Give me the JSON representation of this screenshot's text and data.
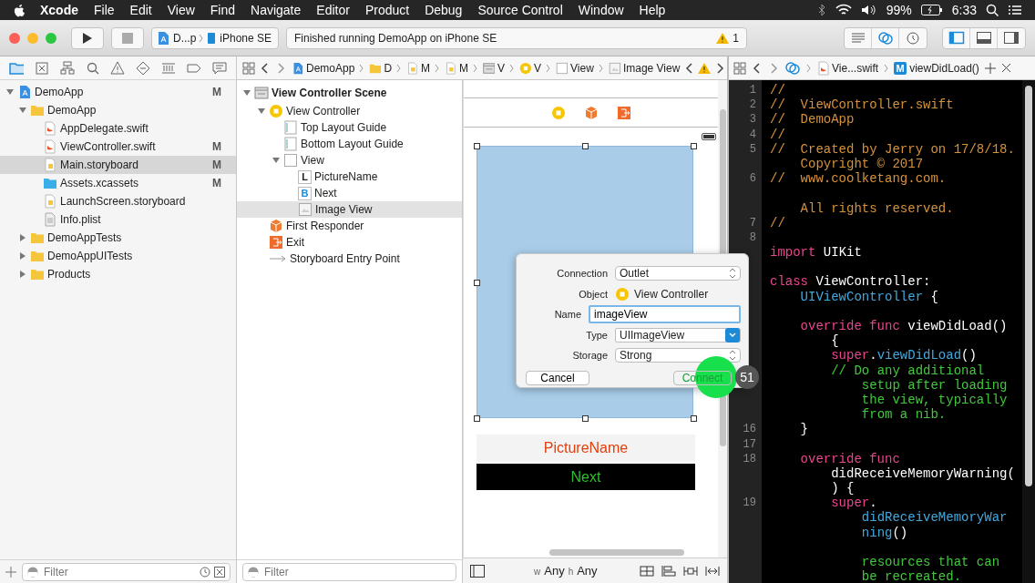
{
  "menu_bar": {
    "app": "Xcode",
    "menus": [
      "File",
      "Edit",
      "View",
      "Find",
      "Navigate",
      "Editor",
      "Product",
      "Debug",
      "Source Control",
      "Window",
      "Help"
    ],
    "battery": "99%",
    "time": "6:33"
  },
  "toolbar": {
    "scheme": "D...p",
    "device": "iPhone SE",
    "status": "Finished running DemoApp on iPhone SE",
    "warnings": "1"
  },
  "navigator": {
    "items": [
      {
        "label": "DemoApp",
        "kind": "project",
        "badge": "M",
        "expanded": true,
        "selected": false,
        "children": [
          {
            "label": "DemoApp",
            "kind": "folder",
            "expanded": true,
            "selected": false,
            "children": [
              {
                "label": "AppDelegate.swift",
                "kind": "swift",
                "selected": false
              },
              {
                "label": "ViewController.swift",
                "kind": "swift",
                "badge": "M",
                "selected": false
              },
              {
                "label": "Main.storyboard",
                "kind": "storyboard",
                "badge": "M",
                "selected": true
              },
              {
                "label": "Assets.xcassets",
                "kind": "assets",
                "badge": "M",
                "selected": false
              },
              {
                "label": "LaunchScreen.storyboard",
                "kind": "storyboard",
                "selected": false
              },
              {
                "label": "Info.plist",
                "kind": "plist",
                "selected": false
              }
            ]
          },
          {
            "label": "DemoAppTests",
            "kind": "folder",
            "expanded": false,
            "selected": false
          },
          {
            "label": "DemoAppUITests",
            "kind": "folder",
            "expanded": false,
            "selected": false
          },
          {
            "label": "Products",
            "kind": "folder",
            "expanded": false,
            "selected": false
          }
        ]
      }
    ],
    "filter_placeholder": "Filter"
  },
  "jump_bar": [
    {
      "label": "DemoApp",
      "kind": "project"
    },
    {
      "label": "D",
      "kind": "folder"
    },
    {
      "label": "M",
      "kind": "storyboard"
    },
    {
      "label": "M",
      "kind": "storyboard"
    },
    {
      "label": "V",
      "kind": "scene"
    },
    {
      "label": "V",
      "kind": "vc"
    },
    {
      "label": "View",
      "kind": "view"
    },
    {
      "label": "Image View",
      "kind": "imageview"
    }
  ],
  "outline": {
    "items": [
      {
        "label": "View Controller Scene",
        "kind": "scene",
        "expanded": true,
        "selected": false,
        "children": [
          {
            "label": "View Controller",
            "kind": "vc",
            "expanded": true,
            "selected": false,
            "children": [
              {
                "label": "Top Layout Guide",
                "kind": "guide",
                "selected": false
              },
              {
                "label": "Bottom Layout Guide",
                "kind": "guide",
                "selected": false
              },
              {
                "label": "View",
                "kind": "view",
                "expanded": true,
                "selected": false,
                "children": [
                  {
                    "label": "PictureName",
                    "kind": "label",
                    "glyph": "L",
                    "selected": false
                  },
                  {
                    "label": "Next",
                    "kind": "button",
                    "glyph": "B",
                    "selected": false
                  },
                  {
                    "label": "Image View",
                    "kind": "imageview",
                    "selected": true
                  }
                ]
              }
            ]
          },
          {
            "label": "First Responder",
            "kind": "responder",
            "selected": false
          },
          {
            "label": "Exit",
            "kind": "exit",
            "selected": false
          },
          {
            "label": "Storyboard Entry Point",
            "kind": "entry",
            "selected": false
          }
        ]
      }
    ],
    "filter_placeholder": "Filter"
  },
  "canvas": {
    "label_text": "PictureName",
    "button_text": "Next",
    "width_prefix": "w",
    "width_class": "Any",
    "height_prefix": "h",
    "height_class": "Any"
  },
  "connection_dialog": {
    "fields": [
      {
        "kind": "popup",
        "label": "Connection",
        "value": "Outlet"
      },
      {
        "kind": "object",
        "label": "Object",
        "value": "View Controller"
      },
      {
        "kind": "input",
        "label": "Name",
        "value": "imageView"
      },
      {
        "kind": "combo",
        "label": "Type",
        "value": "UIImageView"
      },
      {
        "kind": "popup",
        "label": "Storage",
        "value": "Strong"
      }
    ],
    "buttons": [
      {
        "label": "Cancel",
        "kind": "cancel"
      },
      {
        "label": "Connect",
        "kind": "default"
      }
    ],
    "step_badge": "51"
  },
  "editor": {
    "file": "Vie...swift",
    "method_badge": "M",
    "symbol": "viewDidLoad()",
    "lines": [
      {
        "num": "1",
        "rows": [
          {
            "tokens": [
              {
                "kind": "doc",
                "text": "//"
              }
            ]
          }
        ]
      },
      {
        "num": "2",
        "rows": [
          {
            "tokens": [
              {
                "kind": "doc",
                "text": "//  ViewController.swift"
              }
            ]
          }
        ]
      },
      {
        "num": "3",
        "rows": [
          {
            "tokens": [
              {
                "kind": "doc",
                "text": "//  DemoApp"
              }
            ]
          }
        ]
      },
      {
        "num": "4",
        "rows": [
          {
            "tokens": [
              {
                "kind": "doc",
                "text": "//"
              }
            ]
          }
        ]
      },
      {
        "num": "5",
        "rows": [
          {
            "tokens": [
              {
                "kind": "doc",
                "text": "//  Created by Jerry on 17/8/18."
              }
            ]
          },
          {
            "lead": "    ",
            "tokens": [
              {
                "kind": "doc",
                "text": "Copyright © 2017"
              }
            ]
          }
        ]
      },
      {
        "num": "6",
        "rows": [
          {
            "tokens": [
              {
                "kind": "doc",
                "text": "//  www.coolketang.com."
              }
            ]
          },
          {
            "tokens": []
          },
          {
            "lead": "    ",
            "tokens": [
              {
                "kind": "doc",
                "text": "All rights reserved."
              }
            ]
          }
        ]
      },
      {
        "num": "7",
        "rows": [
          {
            "tokens": [
              {
                "kind": "doc",
                "text": "//"
              }
            ]
          }
        ]
      },
      {
        "num": "8",
        "rows": [
          {
            "tokens": []
          }
        ]
      },
      {
        "rows": [
          {
            "tokens": [
              {
                "kind": "keyword",
                "text": "import"
              },
              {
                "kind": "plain",
                "text": " UIKit"
              }
            ]
          }
        ]
      },
      {
        "rows": [
          {
            "tokens": []
          }
        ]
      },
      {
        "rows": [
          {
            "tokens": [
              {
                "kind": "keyword",
                "text": "class"
              },
              {
                "kind": "plain",
                "text": " ViewController:"
              }
            ]
          },
          {
            "lead": "    ",
            "tokens": [
              {
                "kind": "type",
                "text": "UIViewController"
              },
              {
                "kind": "plain",
                "text": " {"
              }
            ]
          }
        ]
      },
      {
        "rows": [
          {
            "tokens": []
          }
        ]
      },
      {
        "rows": [
          {
            "lead": "    ",
            "tokens": [
              {
                "kind": "keyword",
                "text": "override func"
              },
              {
                "kind": "plain",
                "text": " viewDidLoad()"
              }
            ]
          },
          {
            "lead": "        ",
            "tokens": [
              {
                "kind": "plain",
                "text": "{"
              }
            ]
          }
        ]
      },
      {
        "rows": [
          {
            "lead": "        ",
            "tokens": [
              {
                "kind": "keyword",
                "text": "super"
              },
              {
                "kind": "plain",
                "text": "."
              },
              {
                "kind": "type",
                "text": "viewDidLoad"
              },
              {
                "kind": "plain",
                "text": "()"
              }
            ]
          }
        ]
      },
      {
        "rows": [
          {
            "lead": "        ",
            "tokens": [
              {
                "kind": "comment",
                "text": "// Do any additional"
              }
            ]
          },
          {
            "lead": "            ",
            "tokens": [
              {
                "kind": "comment",
                "text": "setup after loading"
              }
            ]
          },
          {
            "lead": "            ",
            "tokens": [
              {
                "kind": "comment",
                "text": "the view, typically"
              }
            ]
          },
          {
            "lead": "            ",
            "tokens": [
              {
                "kind": "comment",
                "text": "from a nib."
              }
            ]
          }
        ]
      },
      {
        "num": "16",
        "rows": [
          {
            "lead": "    ",
            "tokens": [
              {
                "kind": "plain",
                "text": "}"
              }
            ]
          }
        ]
      },
      {
        "num": "17",
        "rows": [
          {
            "tokens": []
          }
        ]
      },
      {
        "num": "18",
        "rows": [
          {
            "lead": "    ",
            "tokens": [
              {
                "kind": "keyword",
                "text": "override func"
              }
            ]
          },
          {
            "lead": "        ",
            "tokens": [
              {
                "kind": "plain",
                "text": "didReceiveMemoryWarning("
              }
            ]
          },
          {
            "lead": "        ",
            "tokens": [
              {
                "kind": "plain",
                "text": ") {"
              }
            ]
          }
        ]
      },
      {
        "num": "19",
        "rows": [
          {
            "lead": "        ",
            "tokens": [
              {
                "kind": "keyword",
                "text": "super"
              },
              {
                "kind": "plain",
                "text": "."
              }
            ]
          },
          {
            "lead": "            ",
            "tokens": [
              {
                "kind": "type",
                "text": "didReceiveMemoryWar"
              }
            ]
          },
          {
            "lead": "            ",
            "tokens": [
              {
                "kind": "type",
                "text": "ning"
              },
              {
                "kind": "plain",
                "text": "()"
              }
            ]
          }
        ]
      },
      {
        "rows": [
          {
            "tokens": []
          },
          {
            "lead": "            ",
            "tokens": [
              {
                "kind": "comment",
                "text": "resources that can"
              }
            ]
          },
          {
            "lead": "            ",
            "tokens": [
              {
                "kind": "comment",
                "text": "be recreated."
              }
            ]
          }
        ]
      }
    ]
  }
}
